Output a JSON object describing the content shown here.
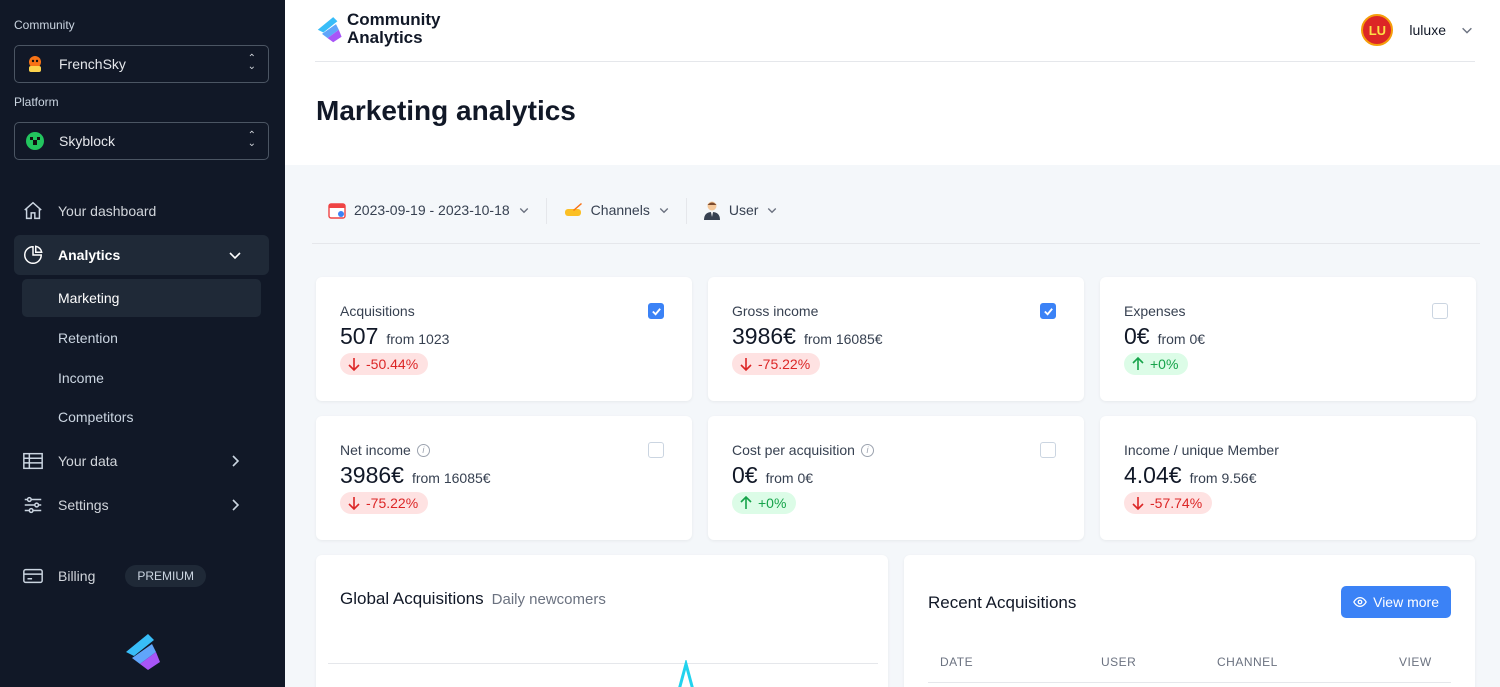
{
  "sidebar": {
    "community_label": "Community",
    "community_value": "FrenchSky",
    "platform_label": "Platform",
    "platform_value": "Skyblock",
    "nav": {
      "dashboard": "Your dashboard",
      "analytics": "Analytics",
      "marketing": "Marketing",
      "retention": "Retention",
      "income": "Income",
      "competitors": "Competitors",
      "your_data": "Your data",
      "settings": "Settings",
      "billing": "Billing",
      "billing_badge": "PREMIUM"
    }
  },
  "header": {
    "logo_line1": "Community",
    "logo_line2": "Analytics",
    "username": "luluxe",
    "avatar_text": "LU",
    "page_title": "Marketing analytics"
  },
  "filters": {
    "date_range": "2023-09-19 - 2023-10-18",
    "channels": "Channels",
    "user": "User"
  },
  "cards": [
    {
      "title": "Acquisitions",
      "value": "507",
      "from": "from 1023",
      "change": "-50.44%",
      "direction": "down",
      "checked": true
    },
    {
      "title": "Gross income",
      "value": "3986€",
      "from": "from 16085€",
      "change": "-75.22%",
      "direction": "down",
      "checked": true
    },
    {
      "title": "Expenses",
      "value": "0€",
      "from": "from 0€",
      "change": "+0%",
      "direction": "up",
      "checked": false
    },
    {
      "title": "Net income",
      "value": "3986€",
      "from": "from 16085€",
      "change": "-75.22%",
      "direction": "down",
      "checked": false,
      "info": true
    },
    {
      "title": "Cost per acquisition",
      "value": "0€",
      "from": "from 0€",
      "change": "+0%",
      "direction": "up",
      "checked": false,
      "info": true
    },
    {
      "title": "Income / unique Member",
      "value": "4.04€",
      "from": "from 9.56€",
      "change": "-57.74%",
      "direction": "down",
      "checked": false
    }
  ],
  "global_acquisitions": {
    "title": "Global Acquisitions",
    "subtitle": "Daily newcomers"
  },
  "recent_acquisitions": {
    "title": "Recent Acquisitions",
    "view_more": "View more",
    "columns": [
      "DATE",
      "USER",
      "CHANNEL",
      "VIEW"
    ]
  },
  "colors": {
    "sidebar_bg": "#111827",
    "accent": "#3b82f6",
    "negative": "#dc2626",
    "positive": "#16a34a"
  }
}
